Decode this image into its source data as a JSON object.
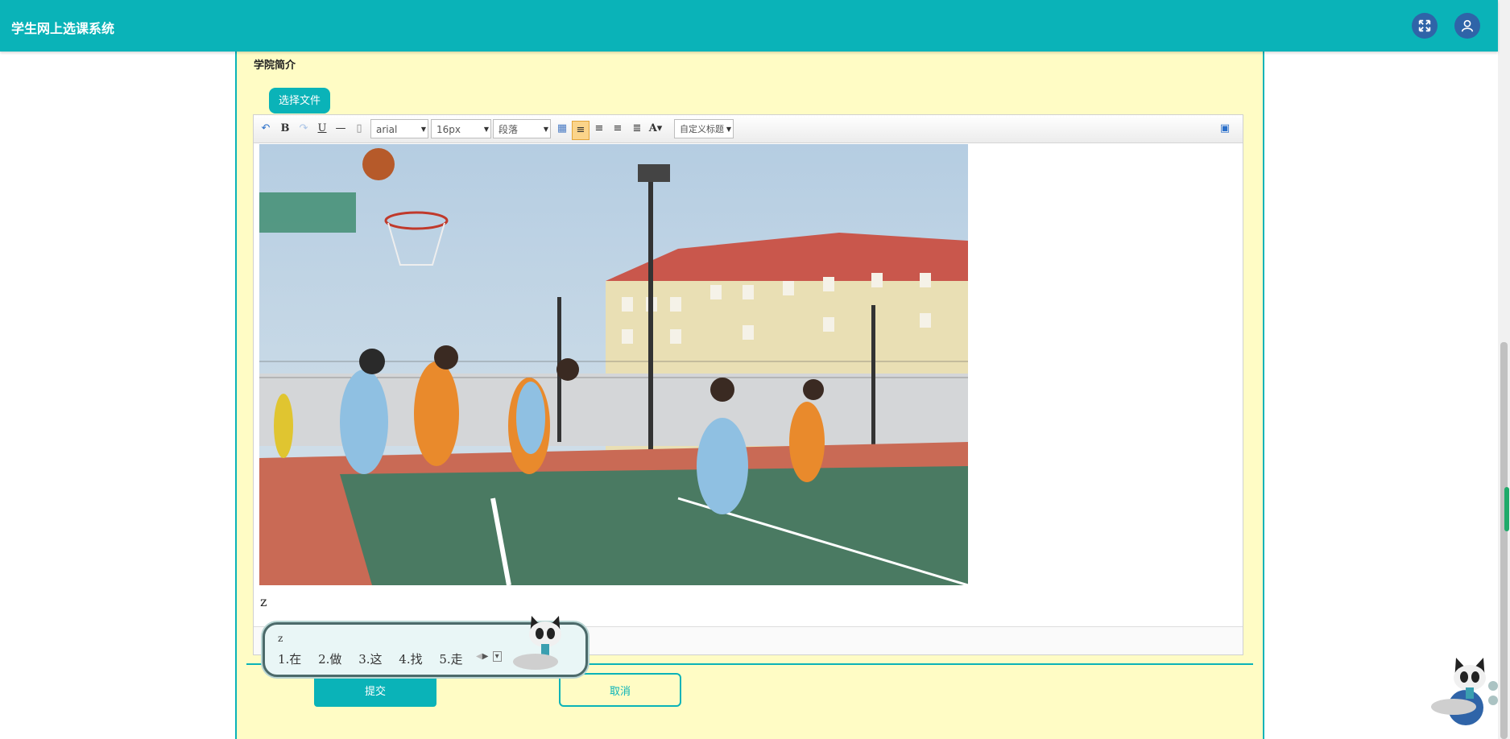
{
  "header": {
    "title": "学生网上选课系统",
    "fullscreen_icon": "expand-icon",
    "user_icon": "user-icon"
  },
  "form": {
    "section_label": "学院简介",
    "choose_file_label": "选择文件"
  },
  "toolbar": {
    "font_family": "arial",
    "font_size": "16px",
    "paragraph": "段落",
    "custom_title": "自定义标题",
    "icons": [
      "undo-icon",
      "bold-icon",
      "redo-icon",
      "underline-icon",
      "horizontal-rule-icon",
      "paste-icon",
      "table-icon",
      "align-left-icon",
      "align-right-icon",
      "align-center-icon",
      "justify-icon",
      "font-color-icon",
      "preview-icon"
    ]
  },
  "editor": {
    "typed_text": "z"
  },
  "ime": {
    "composition": "z",
    "candidates": [
      "1.在",
      "2.做",
      "3.这",
      "4.找",
      "5.走"
    ]
  },
  "buttons": {
    "submit": "提交",
    "cancel": "取消"
  },
  "colors": {
    "primary": "#0ab3b8",
    "panel_bg": "#fffcc5",
    "icon_circle": "#2f64a8"
  }
}
